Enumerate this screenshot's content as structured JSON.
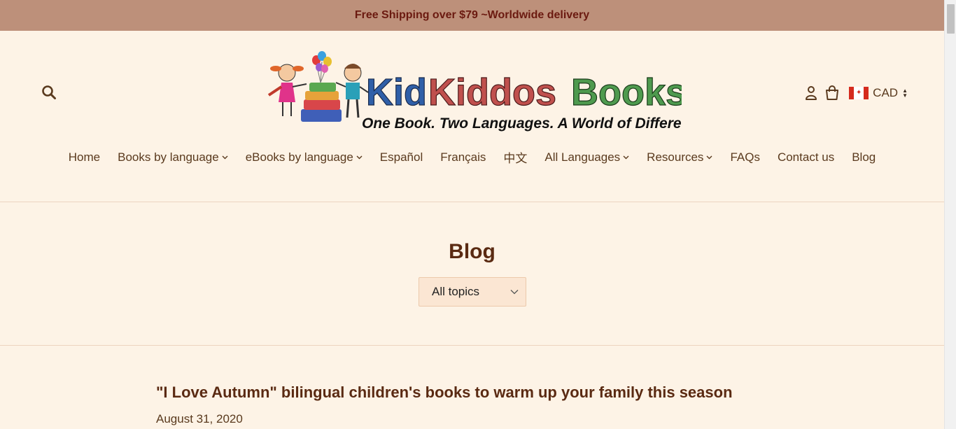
{
  "announcement": {
    "text": "Free Shipping over $79 ~Worldwide delivery"
  },
  "header": {
    "logo": {
      "brand": "KidKiddos Books",
      "brand_parts": [
        "Kid",
        "Kiddos",
        "Books"
      ],
      "tagline": "One Book. Two Languages. A World of Difference!"
    },
    "currency": {
      "code": "CAD",
      "flag": "canada-flag-icon"
    },
    "icons": {
      "search": "search-icon",
      "account": "user-icon",
      "cart": "cart-icon"
    }
  },
  "nav": {
    "items": [
      {
        "label": "Home",
        "dropdown": false
      },
      {
        "label": "Books by language",
        "dropdown": true
      },
      {
        "label": "eBooks by language",
        "dropdown": true
      },
      {
        "label": "Español",
        "dropdown": false
      },
      {
        "label": "Français",
        "dropdown": false
      },
      {
        "label": "中文",
        "dropdown": false
      },
      {
        "label": "All Languages",
        "dropdown": true
      },
      {
        "label": "Resources",
        "dropdown": true
      },
      {
        "label": "FAQs",
        "dropdown": false
      },
      {
        "label": "Contact us",
        "dropdown": false
      },
      {
        "label": "Blog",
        "dropdown": false
      }
    ]
  },
  "blog": {
    "title": "Blog",
    "topic_select": {
      "selected": "All topics"
    },
    "article": {
      "title": "\"I Love Autumn\" bilingual children's books to warm up your family this season",
      "date": "August 31, 2020"
    }
  },
  "colors": {
    "announcement_bg": "#bd907a",
    "announcement_text": "#6b1a10",
    "page_bg": "#fdf3e6",
    "heading": "#5a2a12",
    "brand_blue": "#2f5fa8",
    "brand_red": "#c0504d",
    "brand_green": "#4e9a4e"
  }
}
